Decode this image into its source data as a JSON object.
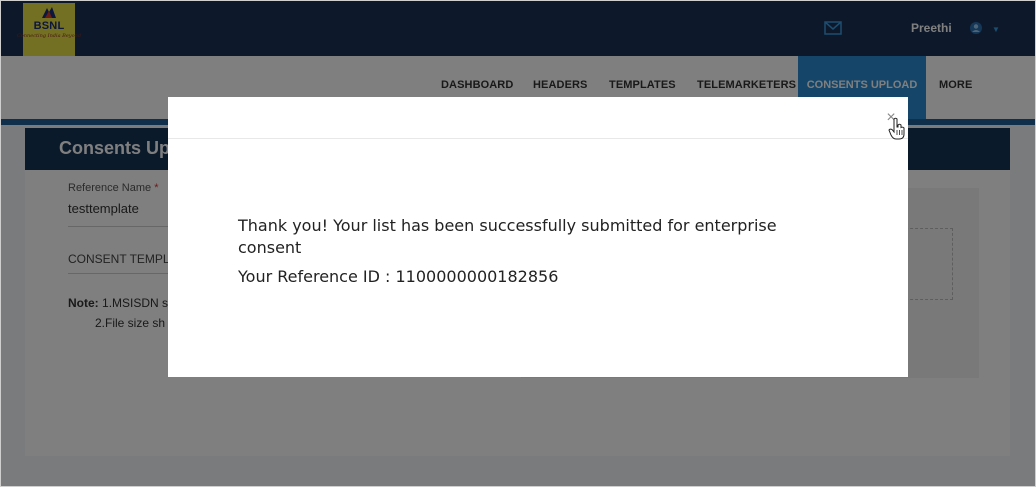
{
  "brand": {
    "name": "BSNL",
    "tagline": "Connecting India Beyond"
  },
  "header": {
    "user_name": "Preethi",
    "mail_icon": "mail-icon",
    "user_icon": "user-circle-icon",
    "caret_icon": "chevron-down-icon"
  },
  "nav": {
    "items": [
      "DASHBOARD",
      "HEADERS",
      "TEMPLATES",
      "TELEMARKETERS",
      "CONSENTS UPLOAD",
      "MORE"
    ],
    "active": "CONSENTS UPLOAD"
  },
  "page": {
    "title": "Consents Upl",
    "reference_label": "Reference Name",
    "required_mark": "*",
    "reference_value": "testtemplate",
    "consent_template_label": "CONSENT TEMPL",
    "note_prefix": "Note:",
    "note_1": "1.MSISDN s",
    "note_2": "2.File size sh"
  },
  "modal": {
    "close_label": "×",
    "message": "Thank you! Your list has been successfully submitted for enterprise consent",
    "reference_text": "Your Reference ID : 1100000000182856"
  },
  "colors": {
    "topbar": "#1a3354",
    "nav_active": "#2a8ad0",
    "panel_header": "#173456",
    "logo_bg": "#e9e047"
  }
}
